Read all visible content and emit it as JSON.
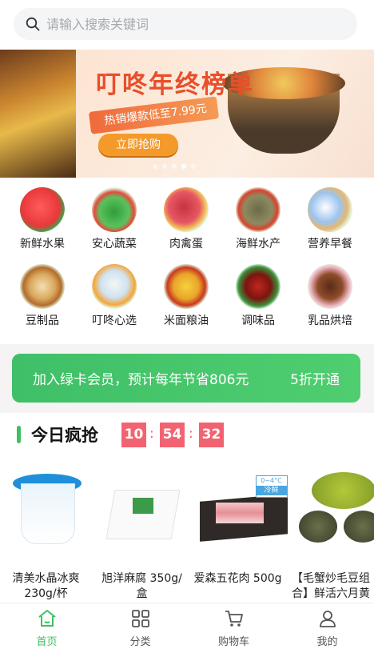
{
  "search": {
    "placeholder": "请输入搜索关键词"
  },
  "banner": {
    "title": "叮咚年终榜单",
    "subtitle": "热销爆款低至7.99元",
    "button": "立即抢购",
    "slide_count": 5,
    "active_slide": 4
  },
  "categories": [
    {
      "label": "新鲜水果",
      "icon": "watermelon-icon"
    },
    {
      "label": "安心蔬菜",
      "icon": "vegetable-icon"
    },
    {
      "label": "肉禽蛋",
      "icon": "meat-icon"
    },
    {
      "label": "海鲜水产",
      "icon": "fish-icon"
    },
    {
      "label": "营养早餐",
      "icon": "breakfast-icon"
    },
    {
      "label": "豆制品",
      "icon": "tofu-icon"
    },
    {
      "label": "叮咚心选",
      "icon": "selection-icon"
    },
    {
      "label": "米面粮油",
      "icon": "grain-oil-icon"
    },
    {
      "label": "调味品",
      "icon": "seasoning-icon"
    },
    {
      "label": "乳品烘培",
      "icon": "dairy-bakery-icon"
    }
  ],
  "vip": {
    "text": "加入绿卡会员，预计每年节省806元",
    "button": "5折开通"
  },
  "flash_sale": {
    "title": "今日疯抢",
    "hours": "10",
    "minutes": "54",
    "seconds": "32",
    "separator": ":"
  },
  "products": [
    {
      "name": "清美水晶冰爽230g/杯"
    },
    {
      "name": "旭洋麻腐 350g/盒"
    },
    {
      "name": "爱森五花肉 500g",
      "badge_temp": "0~4°C",
      "badge_label": "冷鲜"
    },
    {
      "name": "【毛蟹炒毛豆组合】鲜活六月黄"
    }
  ],
  "tabbar": [
    {
      "label": "首页",
      "icon": "home-icon",
      "active": true
    },
    {
      "label": "分类",
      "icon": "category-icon",
      "active": false
    },
    {
      "label": "购物车",
      "icon": "cart-icon",
      "active": false
    },
    {
      "label": "我的",
      "icon": "user-icon",
      "active": false
    }
  ],
  "colors": {
    "accent": "#3dc060",
    "countdown": "#f26372"
  }
}
